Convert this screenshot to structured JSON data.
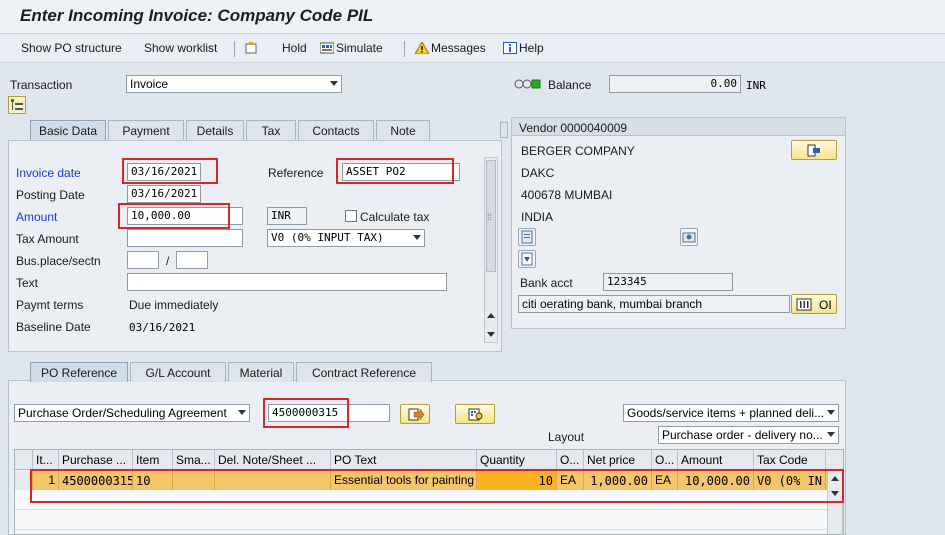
{
  "title": "Enter Incoming Invoice: Company Code PIL",
  "toolbar": {
    "show_po_structure": "Show PO structure",
    "show_worklist": "Show worklist",
    "hold": "Hold",
    "simulate": "Simulate",
    "messages": "Messages",
    "help": "Help"
  },
  "header": {
    "transaction_label": "Transaction",
    "transaction_value": "Invoice",
    "balance_label": "Balance",
    "balance_value": "0.00",
    "balance_currency": "INR"
  },
  "tabs": [
    "Basic Data",
    "Payment",
    "Details",
    "Tax",
    "Contacts",
    "Note"
  ],
  "basic": {
    "invoice_date_label": "Invoice date",
    "invoice_date": "03/16/2021",
    "reference_label": "Reference",
    "reference": "ASSET PO2",
    "posting_date_label": "Posting Date",
    "posting_date": "03/16/2021",
    "amount_label": "Amount",
    "amount": "10,000.00",
    "currency": "INR",
    "calc_tax_label": "Calculate tax",
    "tax_amount_label": "Tax Amount",
    "tax_code": "V0 (0% INPUT TAX)",
    "bus_place_label": "Bus.place/sectn",
    "slash": "/",
    "text_label": "Text",
    "paymt_terms_label": "Paymt terms",
    "paymt_terms": "Due immediately",
    "baseline_label": "Baseline Date",
    "baseline": "03/16/2021"
  },
  "vendor": {
    "title": "Vendor 0000040009",
    "name": "BERGER COMPANY",
    "line2": "DAKC",
    "city": "400678 MUMBAI",
    "country": "INDIA",
    "bank_acct_label": "Bank acct",
    "bank_acct": "123345",
    "bank_name": "citi oerating bank, mumbai branch",
    "oi_label": "OI"
  },
  "ref_tabs": [
    "PO Reference",
    "G/L Account",
    "Material",
    "Contract Reference"
  ],
  "po": {
    "doc_type": "Purchase Order/Scheduling Agreement",
    "po_number": "4500000315",
    "items_select": "Goods/service items + planned deli...",
    "layout_label": "Layout",
    "layout_value": "Purchase order - delivery no..."
  },
  "grid": {
    "headers": [
      "It...",
      "Purchase ...",
      "Item",
      "Sma...",
      "Del. Note/Sheet ...",
      "PO Text",
      "Quantity",
      "O...",
      "Net price",
      "O...",
      "Amount",
      "Tax Code"
    ],
    "row": [
      "1",
      "4500000315",
      "10",
      "",
      "",
      "Essential tools for painting",
      "10",
      "EA",
      "1,000.00",
      "EA",
      "10,000.00",
      "V0 (0% IN..."
    ]
  },
  "colors": {
    "highlight": "#d9262b",
    "row_selected": "#f4c56b",
    "active_link_label": "#1d39c4"
  }
}
